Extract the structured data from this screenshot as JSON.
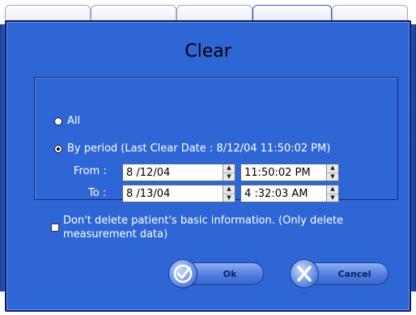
{
  "dialog": {
    "title": "Clear"
  },
  "options": {
    "all_label": "All",
    "by_period_label": "By period (Last Clear Date : 8/12/04 11:50:02 PM)",
    "selected": "by_period"
  },
  "range": {
    "from_label": "From :",
    "to_label": "To :",
    "from_date": "8 /12/04",
    "from_time": "11:50:02 PM",
    "to_date": "8 /13/04",
    "to_time": "4 :32:03 AM"
  },
  "keep_basic_info": {
    "label": "Don't delete patient's basic information. (Only delete measurement data)",
    "checked": false
  },
  "buttons": {
    "ok_label": "Ok",
    "cancel_label": "Cancel"
  },
  "icons": {
    "ok": "check-icon",
    "cancel": "x-icon"
  },
  "colors": {
    "dialog_bg": "#2f66d6",
    "dialog_border": "#0b1e66"
  }
}
